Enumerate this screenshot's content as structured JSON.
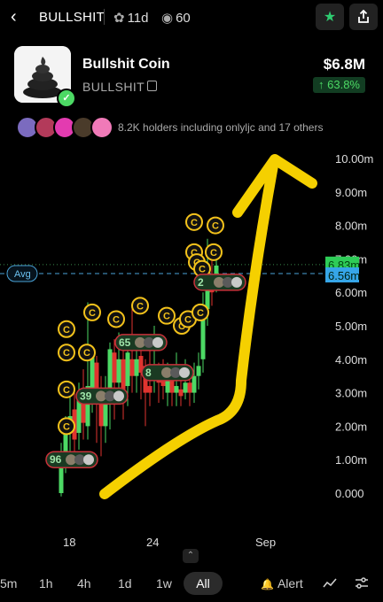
{
  "header": {
    "back_icon": "chevron-left-icon",
    "ticker": "BULLSHIT",
    "age": "11d",
    "age_icon": "sprout-icon",
    "views": "60",
    "views_icon": "eye-icon",
    "watchlist_icon": "star-icon",
    "share_icon": "share-icon"
  },
  "coin": {
    "name": "Bullshit Coin",
    "ticker": "BULLSHIT",
    "market_cap": "$6.8M",
    "change": "↑ 63.8%",
    "verified_icon": "check-badge-icon",
    "accent": "#4cd964"
  },
  "holders": {
    "text": "8.2K holders including onlyljc and 17 others"
  },
  "chart_data": {
    "type": "candlestick",
    "y_ticks": [
      "10.00m",
      "9.00m",
      "8.00m",
      "7.00m",
      "6.00m",
      "5.00m",
      "4.00m",
      "3.00m",
      "2.00m",
      "1.00m",
      "0.000"
    ],
    "ylim": [
      0,
      10
    ],
    "x_ticks": [
      "18",
      "24",
      "Sep"
    ],
    "avg_label": "Avg",
    "avg_value": 6.56,
    "current_value": 6.83,
    "price_tag": "6.83m",
    "avg_tag": "6.56m",
    "up_color": "#4cd964",
    "down_color": "#e0342f",
    "trade_badges": [
      "96",
      "39",
      "65",
      "8",
      "2"
    ]
  },
  "timeframes": [
    "5m",
    "1h",
    "4h",
    "1d",
    "1w",
    "All"
  ],
  "selected_timeframe": "All",
  "toolbar": {
    "alert_label": "Alert",
    "expand_icon": "chevron-up-icon",
    "line_icon": "line-chart-icon",
    "settings_icon": "sliders-icon"
  }
}
